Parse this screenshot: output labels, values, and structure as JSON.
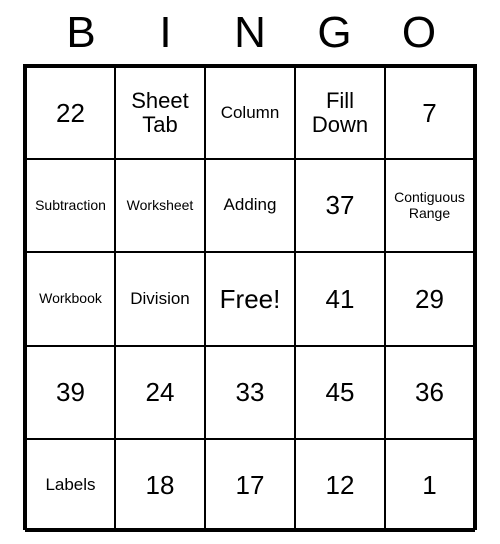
{
  "header": {
    "letters": [
      "B",
      "I",
      "N",
      "G",
      "O"
    ]
  },
  "grid": {
    "rows": [
      [
        {
          "text": "22",
          "size": "normal"
        },
        {
          "text": "Sheet Tab",
          "size": "medium"
        },
        {
          "text": "Column",
          "size": "small"
        },
        {
          "text": "Fill Down",
          "size": "medium"
        },
        {
          "text": "7",
          "size": "normal"
        }
      ],
      [
        {
          "text": "Subtraction",
          "size": "xsmall"
        },
        {
          "text": "Worksheet",
          "size": "xsmall"
        },
        {
          "text": "Adding",
          "size": "small"
        },
        {
          "text": "37",
          "size": "normal"
        },
        {
          "text": "Contiguous Range",
          "size": "xsmall"
        }
      ],
      [
        {
          "text": "Workbook",
          "size": "xsmall"
        },
        {
          "text": "Division",
          "size": "small"
        },
        {
          "text": "Free!",
          "size": "normal"
        },
        {
          "text": "41",
          "size": "normal"
        },
        {
          "text": "29",
          "size": "normal"
        }
      ],
      [
        {
          "text": "39",
          "size": "normal"
        },
        {
          "text": "24",
          "size": "normal"
        },
        {
          "text": "33",
          "size": "normal"
        },
        {
          "text": "45",
          "size": "normal"
        },
        {
          "text": "36",
          "size": "normal"
        }
      ],
      [
        {
          "text": "Labels",
          "size": "small"
        },
        {
          "text": "18",
          "size": "normal"
        },
        {
          "text": "17",
          "size": "normal"
        },
        {
          "text": "12",
          "size": "normal"
        },
        {
          "text": "1",
          "size": "normal"
        }
      ]
    ]
  }
}
